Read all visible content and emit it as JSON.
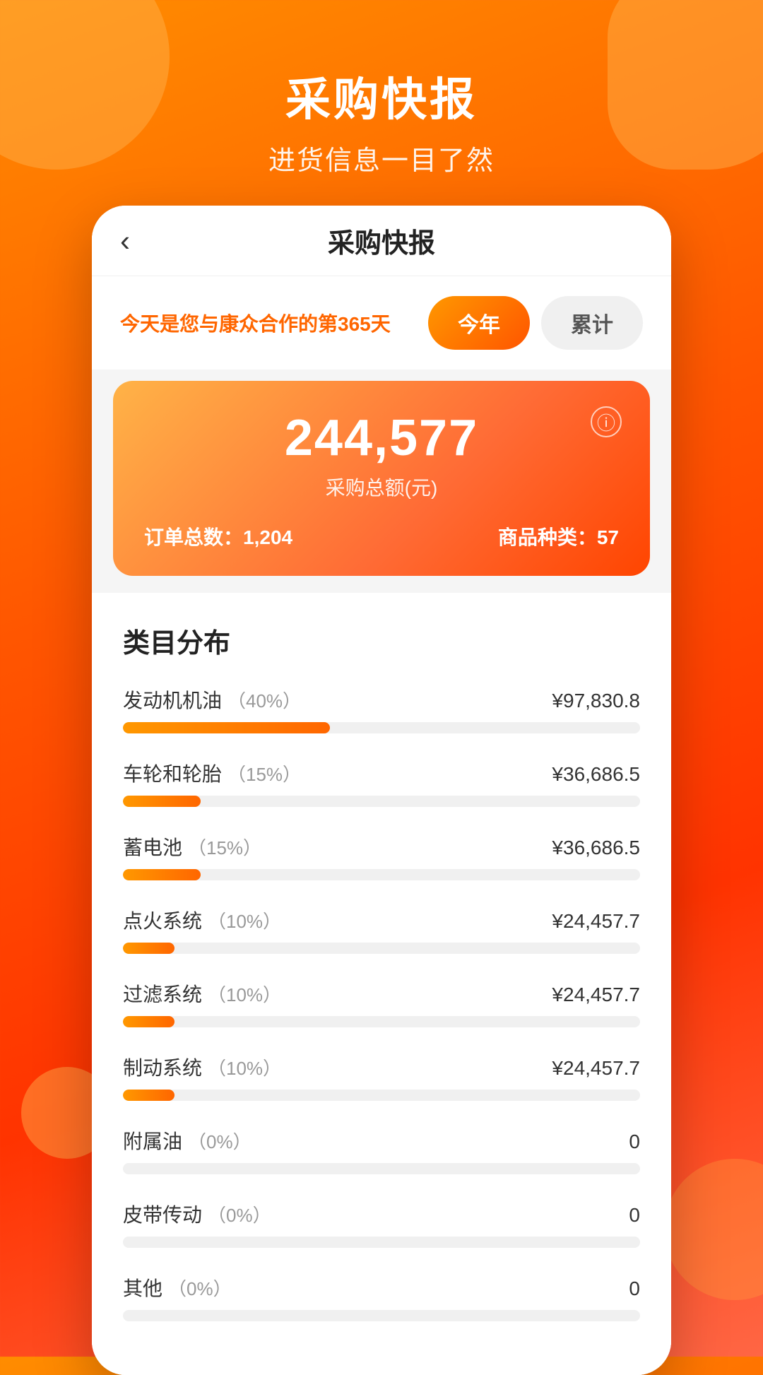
{
  "background": {
    "gradient_start": "#FF8C00",
    "gradient_end": "#FF3300"
  },
  "header": {
    "title": "采购快报",
    "subtitle": "进货信息一目了然"
  },
  "nav": {
    "back_icon": "‹",
    "title": "采购快报"
  },
  "info_bar": {
    "text_prefix": "今天是您与康众合作的第",
    "days": "365",
    "text_suffix": "天",
    "tab_year": "今年",
    "tab_total": "累计"
  },
  "summary": {
    "amount": "244,577",
    "amount_label": "采购总额(元)",
    "info_icon": "ⓘ",
    "order_count_label": "订单总数：",
    "order_count": "1,204",
    "product_types_label": "商品种类：",
    "product_types": "57"
  },
  "categories": {
    "title": "类目分布",
    "items": [
      {
        "name": "发动机机油",
        "pct": "40%",
        "pct_num": 40,
        "amount": "¥97,830.8"
      },
      {
        "name": "车轮和轮胎",
        "pct": "15%",
        "pct_num": 15,
        "amount": "¥36,686.5"
      },
      {
        "name": "蓄电池",
        "pct": "15%",
        "pct_num": 15,
        "amount": "¥36,686.5"
      },
      {
        "name": "点火系统",
        "pct": "10%",
        "pct_num": 10,
        "amount": "¥24,457.7"
      },
      {
        "name": "过滤系统",
        "pct": "10%",
        "pct_num": 10,
        "amount": "¥24,457.7"
      },
      {
        "name": "制动系统",
        "pct": "10%",
        "pct_num": 10,
        "amount": "¥24,457.7"
      },
      {
        "name": "附属油",
        "pct": "0%",
        "pct_num": 0,
        "amount": "0"
      },
      {
        "name": "皮带传动",
        "pct": "0%",
        "pct_num": 0,
        "amount": "0"
      },
      {
        "name": "其他",
        "pct": "0%",
        "pct_num": 0,
        "amount": "0"
      }
    ]
  }
}
